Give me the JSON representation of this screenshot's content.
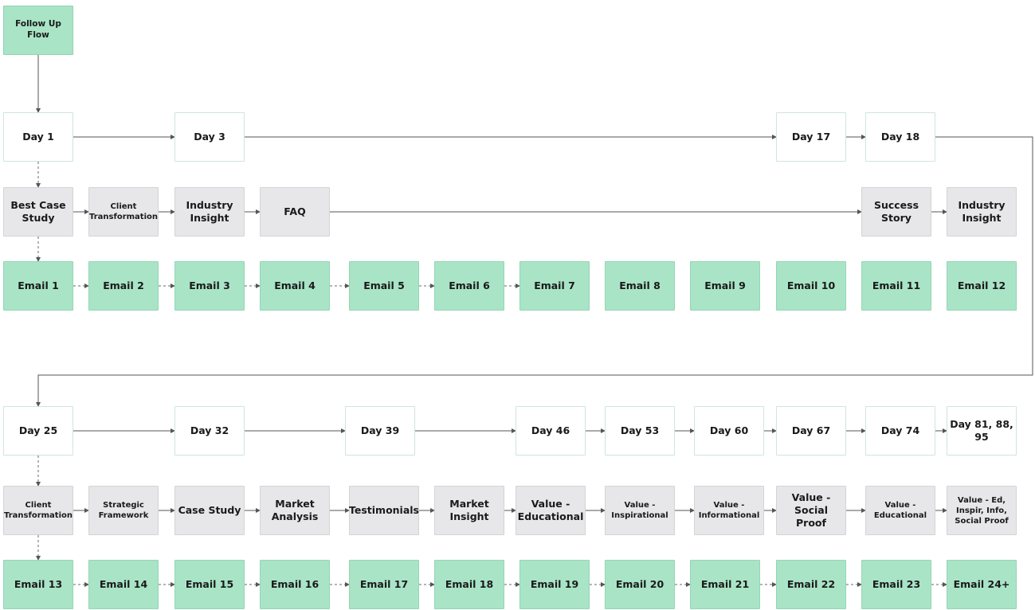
{
  "flow": {
    "start": "Follow Up Flow",
    "row1": {
      "days": [
        "Day 1",
        "Day 3",
        "Day 17",
        "Day 18"
      ],
      "topics": [
        "Best Case Study",
        "Client Transformation",
        "Industry Insight",
        "FAQ",
        "Success Story",
        "Industry Insight"
      ],
      "emails": [
        "Email 1",
        "Email 2",
        "Email 3",
        "Email 4",
        "Email 5",
        "Email 6",
        "Email 7",
        "Email 8",
        "Email 9",
        "Email 10",
        "Email 11",
        "Email 12"
      ]
    },
    "row2": {
      "days": [
        "Day 25",
        "Day 32",
        "Day 39",
        "Day 46",
        "Day 53",
        "Day 60",
        "Day 67",
        "Day 74",
        "Day 81, 88, 95"
      ],
      "topics": [
        "Client Transformation",
        "Strategic Framework",
        "Case Study",
        "Market Analysis",
        "Testimonials",
        "Market Insight",
        "Value - Educational",
        "Value - Inspirational",
        "Value - Informational",
        "Value - Social Proof",
        "Value - Educational",
        "Value - Ed, Inspir, Info, Social Proof"
      ],
      "emails": [
        "Email 13",
        "Email 14",
        "Email 15",
        "Email 16",
        "Email 17",
        "Email 18",
        "Email 19",
        "Email 20",
        "Email 21",
        "Email 22",
        "Email 23",
        "Email 24+"
      ]
    }
  },
  "colors": {
    "email_fill": "#a9e4c7",
    "topic_fill": "#e7e6e8",
    "day_fill": "#ffffff",
    "connector": "#555555"
  }
}
